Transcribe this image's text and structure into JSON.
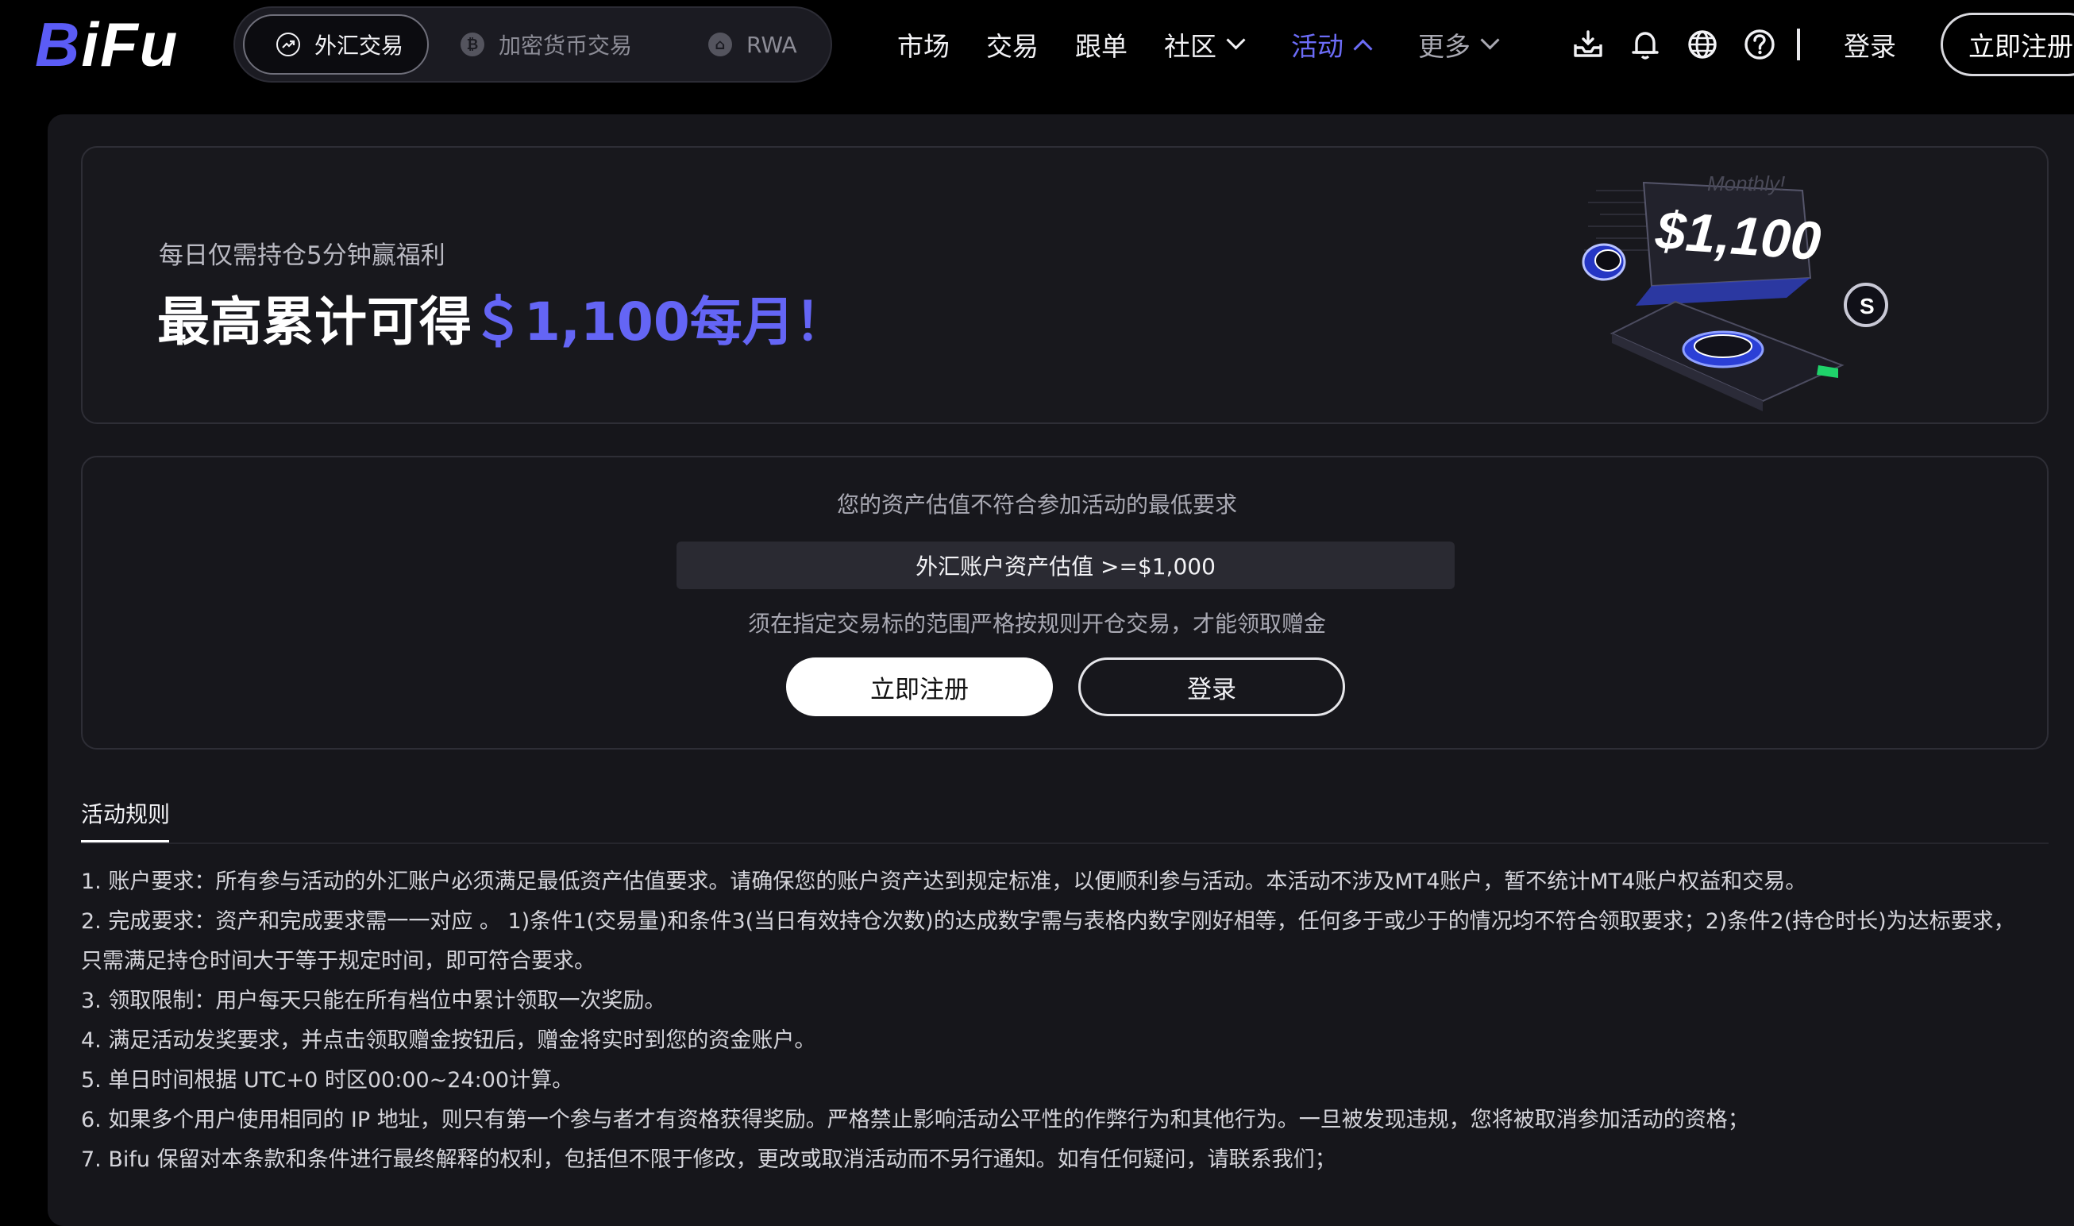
{
  "header": {
    "logo_text": "BiFu",
    "mode_tabs": [
      {
        "label": "外汇交易",
        "icon": "trend-up-icon",
        "active": true
      },
      {
        "label": "加密货币交易",
        "icon": "bitcoin-icon",
        "active": false
      },
      {
        "label": "RWA",
        "icon": "home-icon",
        "active": false
      }
    ],
    "nav": [
      {
        "label": "市场"
      },
      {
        "label": "交易"
      },
      {
        "label": "跟单"
      },
      {
        "label": "社区",
        "dropdown": "down"
      },
      {
        "label": "活动",
        "dropdown": "up",
        "active": true
      },
      {
        "label": "更多",
        "dropdown": "down"
      }
    ],
    "icons": [
      "download-icon",
      "bell-icon",
      "globe-icon",
      "help-icon"
    ],
    "login_label": "登录",
    "register_label": "立即注册",
    "accent_color": "#6c6cf7"
  },
  "banner": {
    "subtitle": "每日仅需持仓5分钟赢福利",
    "title_prefix": "最高累计可得",
    "title_highlight": "＄1,100每月！",
    "art_caption_top": "Monthly!",
    "art_caption_amount": "$1,100"
  },
  "requirement": {
    "message": "您的资产估值不符合参加活动的最低要求",
    "condition": "外汇账户资产估值 >=$1,000",
    "note": "须在指定交易标的范围严格按规则开仓交易，才能领取赠金",
    "register_button": "立即注册",
    "login_button": "登录"
  },
  "rules": {
    "tab_label": "活动规则",
    "items": [
      "1. 账户要求：所有参与活动的外汇账户必须满足最低资产估值要求。请确保您的账户资产达到规定标准，以便顺利参与活动。本活动不涉及MT4账户，暂不统计MT4账户权益和交易。",
      "2. 完成要求：资产和完成要求需一一对应 。 1)条件1(交易量)和条件3(当日有效持仓次数)的达成数字需与表格内数字刚好相等，任何多于或少于的情况均不符合领取要求；2)条件2(持仓时长)为达标要求，只需满足持仓时间大于等于规定时间，即可符合要求。",
      "3. 领取限制：用户每天只能在所有档位中累计领取一次奖励。",
      "4. 满足活动发奖要求，并点击领取赠金按钮后，赠金将实时到您的资金账户。",
      "5. 单日时间根据 UTC+0 时区00:00~24:00计算。",
      "6. 如果多个用户使用相同的 IP 地址，则只有第一个参与者才有资格获得奖励。严格禁止影响活动公平性的作弊行为和其他行为。一旦被发现违规，您将被取消参加活动的资格；",
      "7. Bifu 保留对本条款和条件进行最终解释的权利，包括但不限于修改，更改或取消活动而不另行通知。如有任何疑问，请联系我们；"
    ]
  }
}
